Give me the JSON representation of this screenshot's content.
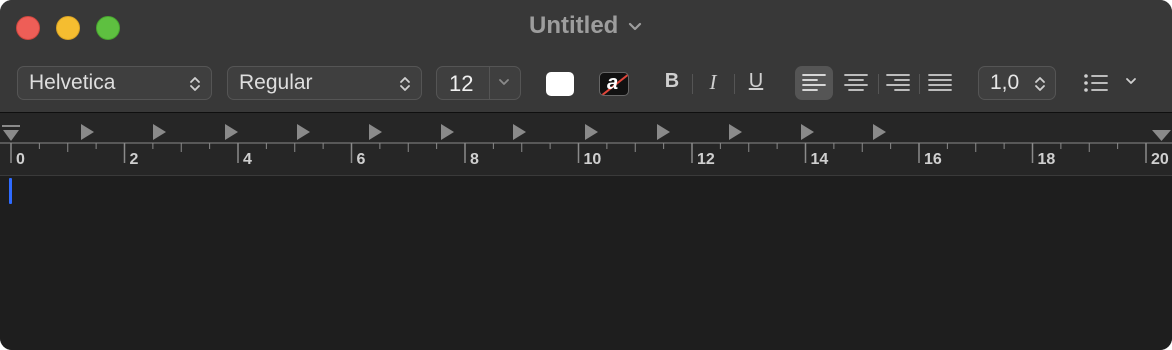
{
  "window": {
    "title": "Untitled"
  },
  "toolbar": {
    "font_family": "Helvetica",
    "font_style": "Regular",
    "font_size": "12",
    "text_color": "#ffffff",
    "background_color_letter": "a",
    "bold_label": "B",
    "italic_label": "I",
    "underline_label": "U",
    "alignment_selected": "left",
    "line_spacing": "1,0"
  },
  "ruler": {
    "unit_labels": [
      "0",
      "2",
      "4",
      "6",
      "8",
      "10",
      "12",
      "14",
      "16",
      "18",
      "20"
    ]
  },
  "editor": {
    "content": ""
  }
}
